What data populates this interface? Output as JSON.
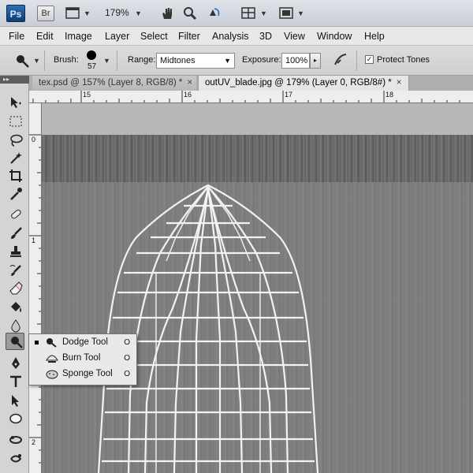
{
  "appbar": {
    "ps_logo": "Ps",
    "br_logo": "Br",
    "zoom": "179%"
  },
  "menu": [
    "File",
    "Edit",
    "Image",
    "Layer",
    "Select",
    "Filter",
    "Analysis",
    "3D",
    "View",
    "Window",
    "Help"
  ],
  "options": {
    "brush_label": "Brush:",
    "brush_size": "57",
    "range_label": "Range:",
    "range_value": "Midtones",
    "exposure_label": "Exposure:",
    "exposure_value": "100%",
    "protect_label": "Protect Tones",
    "protect_checked": true
  },
  "tabs": [
    {
      "label": "tex.psd @ 157% (Layer 8, RGB/8) *",
      "active": false,
      "close": "×"
    },
    {
      "label": "outUV_blade.jpg @ 179% (Layer 0, RGB/8#) *",
      "active": true,
      "close": "×"
    }
  ],
  "ruler": {
    "h_ticks": [
      "15",
      "16",
      "17",
      "18"
    ],
    "v_ticks": [
      "0",
      "1",
      "2"
    ]
  },
  "flyout": [
    {
      "label": "Dodge Tool",
      "shortcut": "O",
      "selected": true,
      "icon": "dodge-icon"
    },
    {
      "label": "Burn Tool",
      "shortcut": "O",
      "selected": false,
      "icon": "burn-icon"
    },
    {
      "label": "Sponge Tool",
      "shortcut": "O",
      "selected": false,
      "icon": "sponge-icon"
    }
  ],
  "colors": {
    "canvas_gray": "#7f7f7f",
    "wireframe": "#f2f2f2",
    "ps_blue": "#2d6fb3"
  }
}
